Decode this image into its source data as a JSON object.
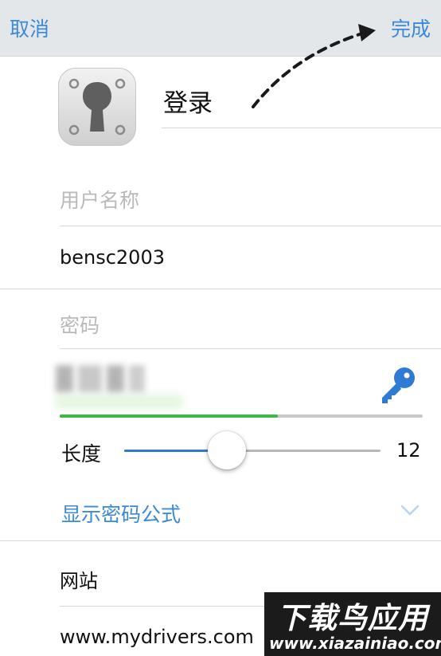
{
  "nav": {
    "cancel": "取消",
    "done": "完成",
    "accent": "#3a8ad9"
  },
  "header": {
    "title": "登录",
    "icon": "keyhole-lock-icon"
  },
  "username": {
    "label": "用户名称",
    "value": "bensc2003"
  },
  "password": {
    "label": "密码",
    "value_obscured": true,
    "generate_icon": "key-icon",
    "strength": 0.6
  },
  "length": {
    "label": "长度",
    "value": "12",
    "min": 4,
    "max": 24,
    "current": 12
  },
  "formula": {
    "label": "显示密码公式",
    "icon": "chevron-down-icon"
  },
  "website": {
    "label": "网站",
    "value": "www.mydrivers.com"
  },
  "watermark": {
    "main": "下载鸟应用",
    "url": "www.xiazainiao.com"
  },
  "colors": {
    "nav_bg": "#e4e7ea",
    "strength_fill": "#3fb84a",
    "slider_fill": "#2f7ad4"
  }
}
